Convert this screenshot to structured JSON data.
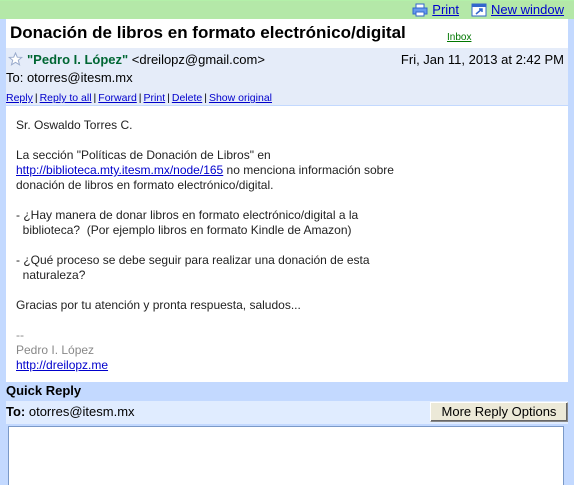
{
  "toolbar": {
    "print_label": "Print",
    "new_window_label": "New window"
  },
  "thread": {
    "subject": "Donación de libros en formato electrónico/digital",
    "label": "Inbox"
  },
  "message": {
    "sender_name": "\"Pedro I. López\"",
    "sender_email": "<dreilopz@gmail.com>",
    "date": "Fri, Jan 11, 2013 at 2:42 PM",
    "to": "To: otorres@itesm.mx",
    "actions": [
      "Reply",
      "Reply to all",
      "Forward",
      "Print",
      "Delete",
      "Show original"
    ],
    "body": {
      "greeting": "Sr. Oswaldo Torres C.",
      "p1_line1": "La sección \"Políticas de Donación de Libros\" en",
      "p1_link": "http://biblioteca.mty.itesm.mx/node/165",
      "p1_rest": " no menciona información sobre",
      "p1_line3": "donación de libros en formato electrónico/digital.",
      "q1_line1": "- ¿Hay manera de donar libros en formato electrónico/digital a la",
      "q1_line2": "  biblioteca?  (Por ejemplo libros en formato Kindle de Amazon)",
      "q2_line1": "- ¿Qué proceso se debe seguir para realizar una donación de esta",
      "q2_line2": "  naturaleza?",
      "closing": "Gracias por tu atención y pronta respuesta, saludos...",
      "sig_dash": "--",
      "sig_name": "Pedro I. López",
      "sig_link": "http://dreilopz.me"
    }
  },
  "quick_reply": {
    "title": "Quick Reply",
    "to_label": "To:",
    "to_value": " otorres@itesm.mx",
    "more_options": "More Reply Options"
  },
  "colors": {
    "top_bar": "#b4e8a8",
    "frame": "#c3d9ff",
    "header_bg": "#e5ecf9",
    "sender": "#006633",
    "link": "#0000cc"
  }
}
